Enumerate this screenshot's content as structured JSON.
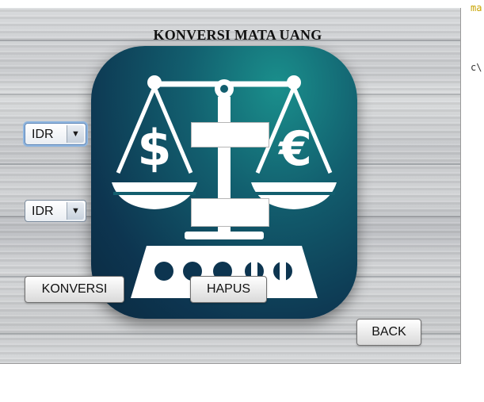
{
  "window": {
    "title": "KONVERSI MATA UANG"
  },
  "form": {
    "from_currency": "IDR",
    "to_currency": "IDR",
    "amount_input": "",
    "result_output": ""
  },
  "buttons": {
    "convert": "KONVERSI",
    "clear": "HAPUS",
    "back": "BACK"
  },
  "logo": {
    "icon": "balance-scale-currency-icon",
    "left_symbol": "$",
    "right_symbol": "€"
  },
  "background_editor": {
    "top_fragment": "ma",
    "middle_fragment": "c\\"
  },
  "colors": {
    "logo_teal": "#1a8f8c",
    "logo_navy": "#0b2a40",
    "editor_fragment_color": "#c8a400"
  }
}
